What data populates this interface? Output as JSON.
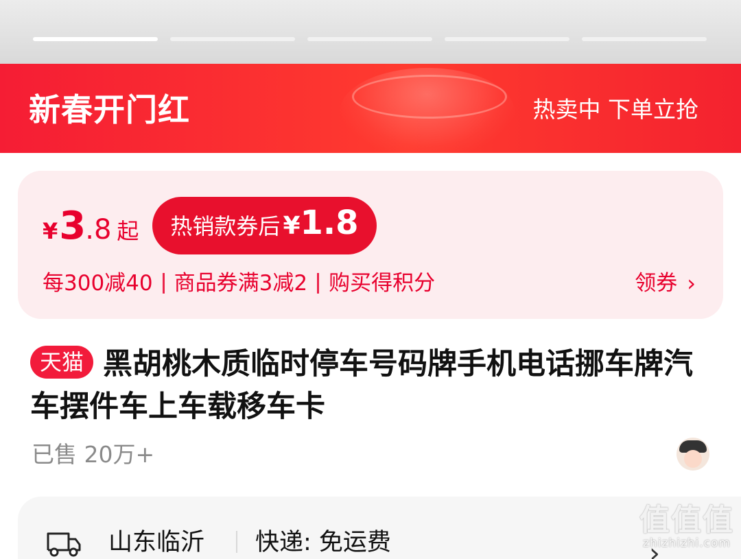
{
  "gallery": {
    "indicator_count": 5,
    "active_index": 0
  },
  "banner": {
    "title": "新春开门红",
    "subtitle": "热卖中 下单立抢"
  },
  "price_card": {
    "currency": "¥",
    "price_int": "3",
    "price_dec": ".8",
    "price_suffix": "起",
    "hot_label": "热销款券后",
    "hot_currency": "¥",
    "hot_price": "1.8",
    "promos": [
      "每300减40",
      "商品券满3减2",
      "购买得积分"
    ],
    "coupon_label": "领券"
  },
  "product": {
    "badge": "天猫",
    "title": "黑胡桃木质临时停车号码牌手机电话挪车牌汽车摆件车上车载移车卡",
    "sold": "已售 20万+"
  },
  "shipping": {
    "origin": "山东临沂",
    "method": "快递: 免运费"
  },
  "watermark": {
    "logo": "值值值",
    "url": "zhizhizhi.com"
  },
  "colors": {
    "accent": "#e8002d",
    "banner": "#f51d34",
    "price_card_bg": "#fdedef"
  }
}
